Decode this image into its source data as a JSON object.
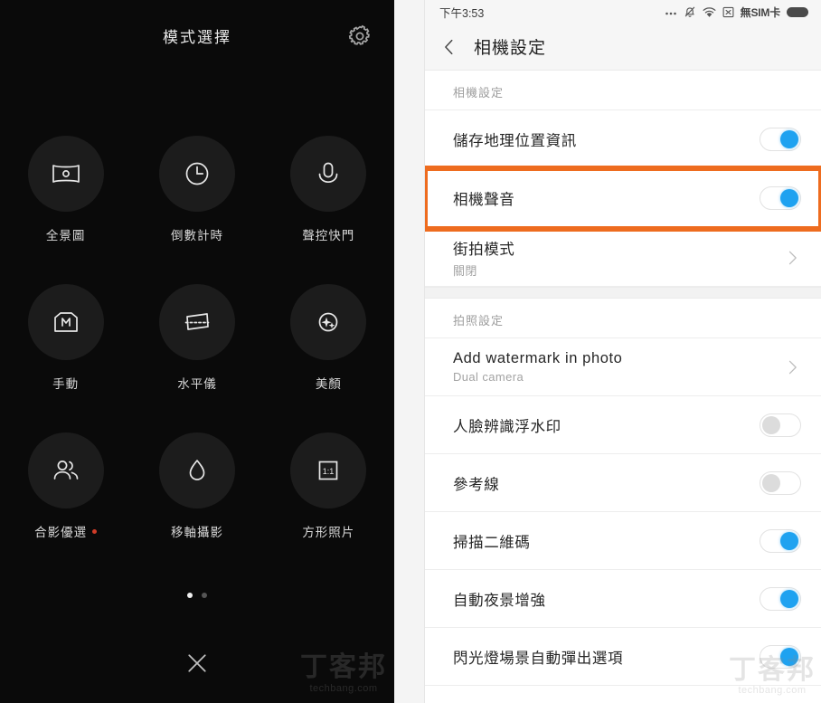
{
  "camera_modes": {
    "title": "模式選擇",
    "gear_icon": "gear-icon",
    "close_icon": "close-icon",
    "page_dots": {
      "count": 2,
      "active_index": 0
    },
    "items": [
      {
        "label": "全景圖",
        "icon": "panorama-icon",
        "badge": ""
      },
      {
        "label": "倒數計時",
        "icon": "timer-clock-icon",
        "badge": ""
      },
      {
        "label": "聲控快門",
        "icon": "microphone-icon",
        "badge": ""
      },
      {
        "label": "手動",
        "icon": "manual-m-icon",
        "badge": ""
      },
      {
        "label": "水平儀",
        "icon": "level-tilt-icon",
        "badge": ""
      },
      {
        "label": "美顏",
        "icon": "beauty-sparkle-icon",
        "badge": ""
      },
      {
        "label": "合影優選",
        "icon": "group-photo-icon",
        "badge": "new-dot"
      },
      {
        "label": "移軸攝影",
        "icon": "water-drop-icon",
        "badge": ""
      },
      {
        "label": "方形照片",
        "icon": "square-ratio-icon",
        "badge": ""
      }
    ],
    "watermark": {
      "cjk": "丁客邦",
      "url": "techbang.com"
    }
  },
  "settings": {
    "status_bar": {
      "time": "下午3:53",
      "icons": [
        "ellipsis-icon",
        "bell-muted-icon",
        "wifi-icon",
        "no-signal-x-icon"
      ],
      "sim_text": "無SIM卡",
      "battery_icon": "battery-icon"
    },
    "app_bar": {
      "back_icon": "back-chevron-icon",
      "title": "相機設定"
    },
    "sections": [
      {
        "header": "相機設定",
        "rows": [
          {
            "title": "儲存地理位置資訊",
            "sub": "",
            "control": "toggle",
            "value": "on",
            "highlighted": false
          },
          {
            "title": "相機聲音",
            "sub": "",
            "control": "toggle",
            "value": "on",
            "highlighted": true
          },
          {
            "title": "街拍模式",
            "sub": "關閉",
            "control": "chevron",
            "value": "",
            "highlighted": false
          }
        ]
      },
      {
        "header": "拍照設定",
        "rows": [
          {
            "title": "Add watermark in photo",
            "sub": "Dual camera",
            "control": "chevron",
            "value": "",
            "highlighted": false
          },
          {
            "title": "人臉辨識浮水印",
            "sub": "",
            "control": "toggle",
            "value": "off",
            "highlighted": false
          },
          {
            "title": "參考線",
            "sub": "",
            "control": "toggle",
            "value": "off",
            "highlighted": false
          },
          {
            "title": "掃描二維碼",
            "sub": "",
            "control": "toggle",
            "value": "on",
            "highlighted": false
          },
          {
            "title": "自動夜景增強",
            "sub": "",
            "control": "toggle",
            "value": "on",
            "highlighted": false
          },
          {
            "title": "閃光燈場景自動彈出選項",
            "sub": "",
            "control": "toggle",
            "value": "on",
            "highlighted": false
          }
        ]
      }
    ],
    "watermark": {
      "cjk": "丁客邦",
      "url": "techbang.com"
    }
  },
  "colors": {
    "accent_blue": "#1fa2f0",
    "highlight_orange": "#ee6c1f",
    "badge_red": "#d03c28",
    "dark_bg": "#0a0a0a"
  }
}
